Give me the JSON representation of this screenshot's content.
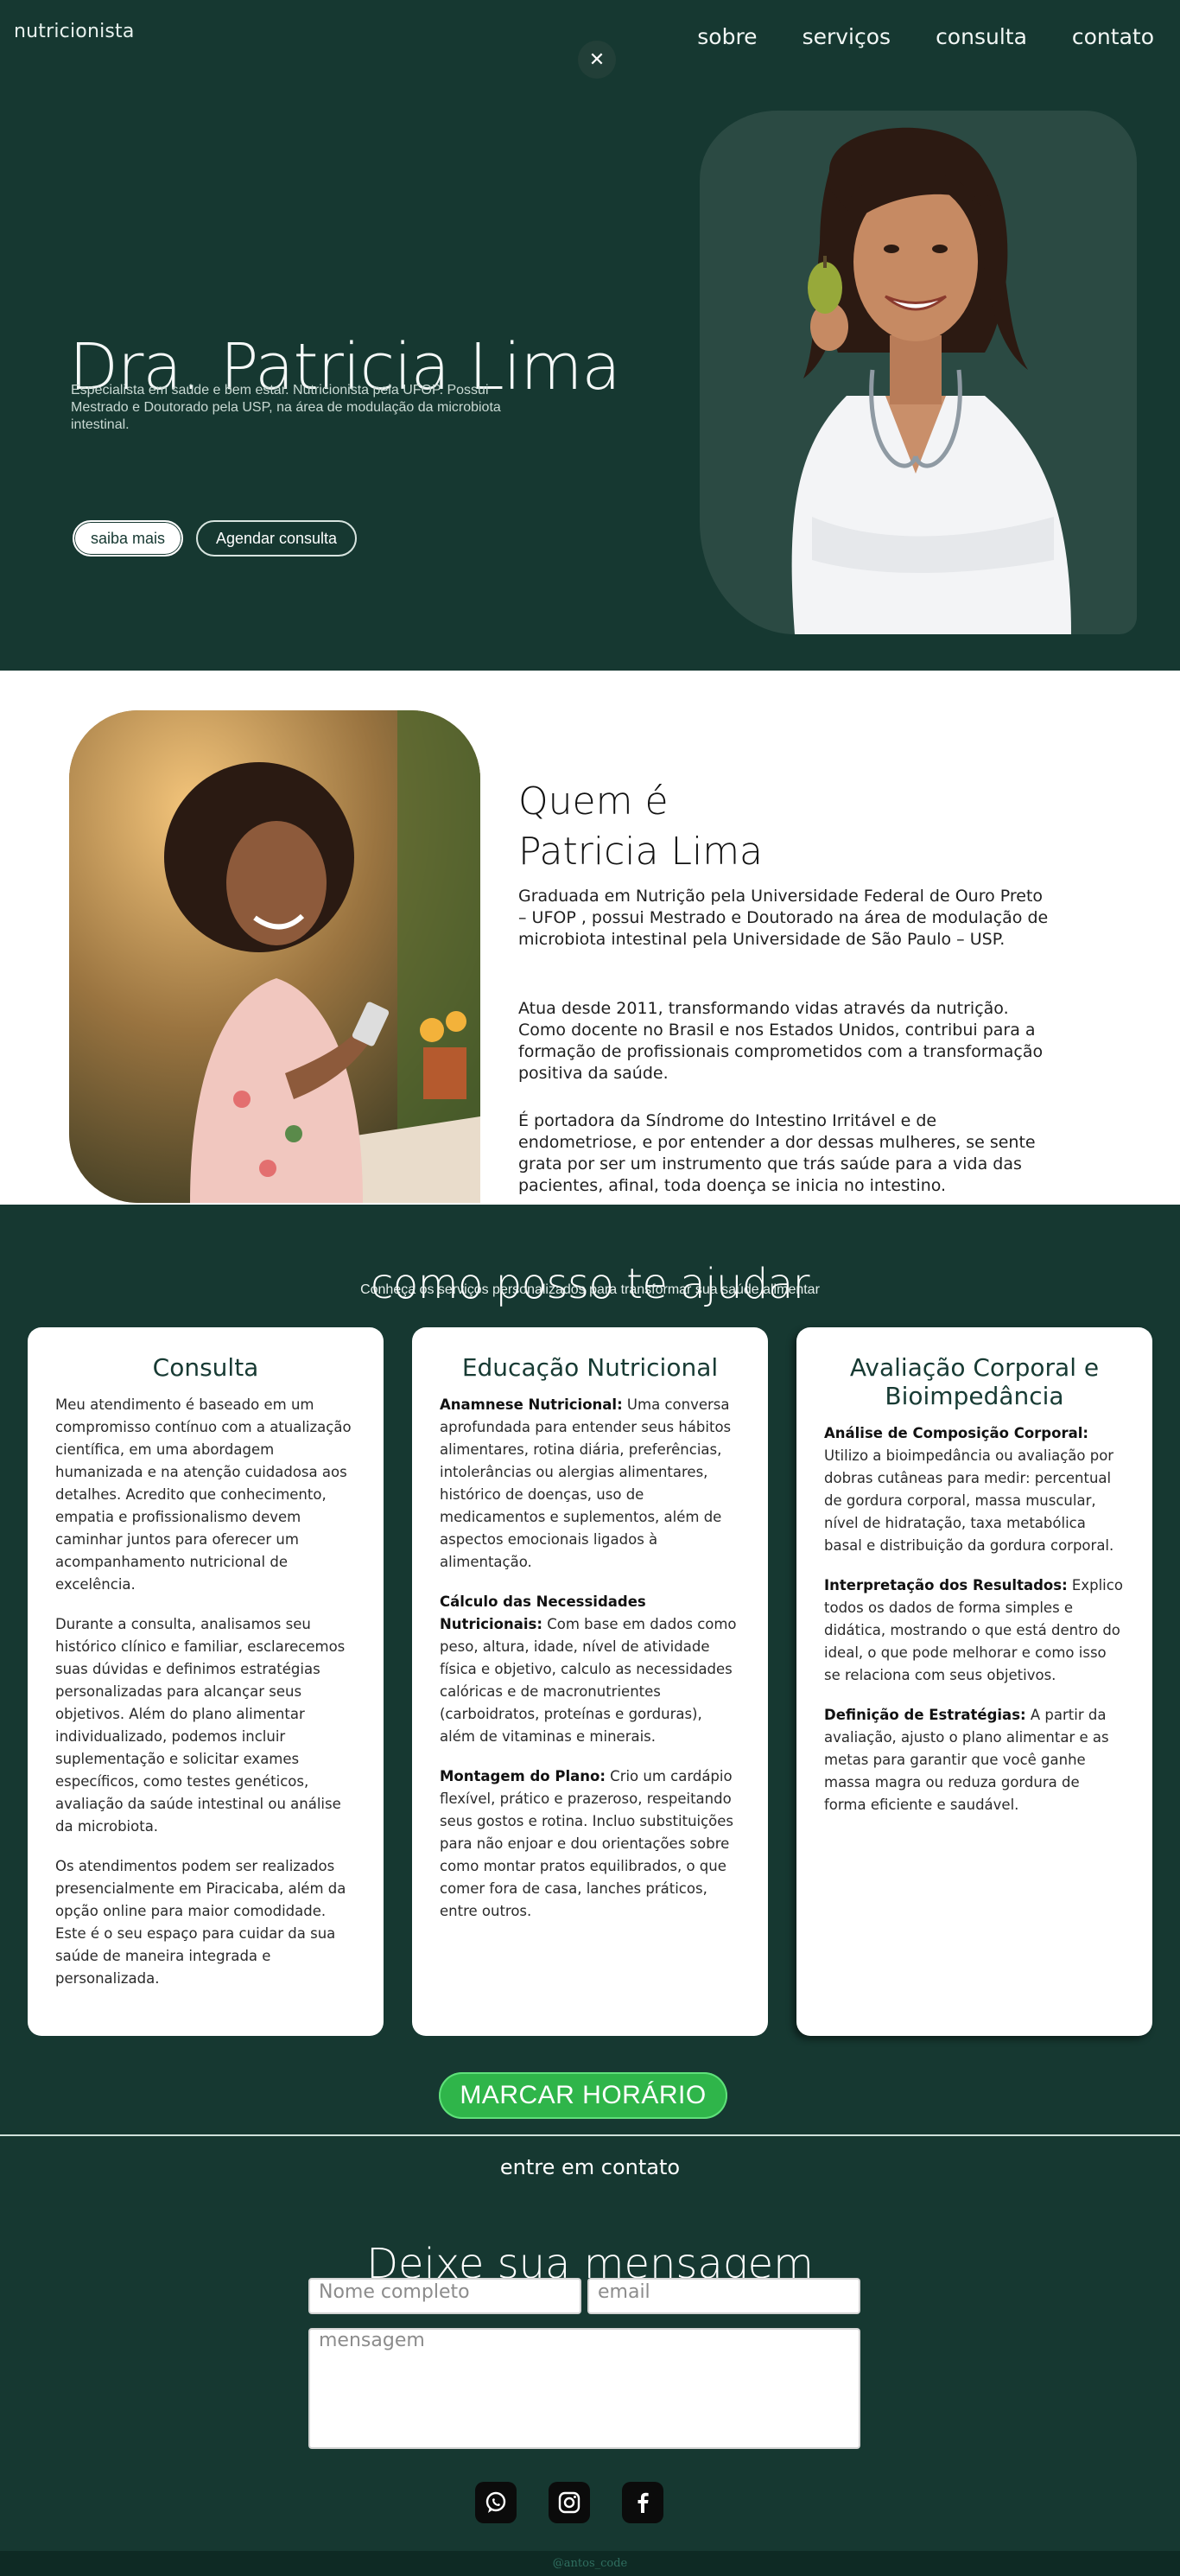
{
  "header": {
    "brand": "nutricionista",
    "nav": [
      "sobre",
      "serviços",
      "consulta",
      "contato"
    ],
    "close_glyph": "✕"
  },
  "hero": {
    "title": "Dra. Patricia Lima",
    "description": "Especialista em saúde e bem estar. Nutricionista pela UFOP. Possui Mestrado e Doutorado pela USP, na área de modulação da microbiota intestinal.",
    "btn_more": "saiba mais",
    "btn_schedule": "Agendar consulta"
  },
  "about": {
    "title_line1": "Quem é",
    "title_line2": "Patricia Lima",
    "p1": "Graduada em Nutrição pela Universidade Federal de Ouro Preto – UFOP , possui Mestrado e Doutorado na área de modulação de microbiota intestinal pela Universidade de São Paulo – USP.",
    "p2": "Atua desde 2011, transformando vidas através da nutrição. Como docente no Brasil e nos Estados Unidos, contribui para a formação de profissionais comprometidos com a transformação positiva da saúde.",
    "p3": "É portadora da Síndrome do Intestino Irritável e de endometriose, e por entender a dor dessas mulheres, se sente grata por ser um instrumento que trás saúde para a vida das pacientes, afinal, toda doença se inicia no intestino."
  },
  "services": {
    "title": "como posso te ajudar",
    "subtitle": "Conheça os serviços personalizados para transformar sua saúde alimentar",
    "card1": {
      "title": "Consulta",
      "p1": "Meu atendimento é baseado em um compromisso contínuo com a atualização científica, em uma abordagem humanizada e na atenção cuidadosa aos detalhes. Acredito que conhecimento, empatia e profissionalismo devem caminhar juntos para oferecer um acompanhamento nutricional de excelência.",
      "p2": "Durante a consulta, analisamos seu histórico clínico e familiar, esclarecemos suas dúvidas e definimos estratégias personalizadas para alcançar seus objetivos. Além do plano alimentar individualizado, podemos incluir suplementação e solicitar exames específicos, como testes genéticos, avaliação da saúde intestinal ou análise da microbiota.",
      "p3": "Os atendimentos podem ser realizados presencialmente em Piracicaba, além da opção online para maior comodidade. Este é o seu espaço para cuidar da sua saúde de maneira integrada e personalizada."
    },
    "card2": {
      "title": "Educação Nutricional",
      "h1": "Anamnese Nutricional:",
      "t1": " Uma conversa aprofundada para entender seus hábitos alimentares, rotina diária, preferências, intolerâncias ou alergias alimentares, histórico de doenças, uso de medicamentos e suplementos, além de aspectos emocionais ligados à alimentação.",
      "h2": "Cálculo das Necessidades Nutricionais:",
      "t2": " Com base em dados como peso, altura, idade, nível de atividade física e objetivo, calculo as necessidades calóricas e de macronutrientes (carboidratos, proteínas e gorduras), além de vitaminas e minerais.",
      "h3": "Montagem do Plano:",
      "t3": " Crio um cardápio flexível, prático e prazeroso, respeitando seus gostos e rotina. Incluo substituições para não enjoar e dou orientações sobre como montar pratos equilibrados, o que comer fora de casa, lanches práticos, entre outros."
    },
    "card3": {
      "title": "Avaliação Corporal e Bioimpedância",
      "h1": "Análise de Composição Corporal:",
      "t1": " Utilizo a bioimpedância ou avaliação por dobras cutâneas para medir: percentual de gordura corporal, massa muscular, nível de hidratação, taxa metabólica basal e distribuição da gordura corporal.",
      "h2": "Interpretação dos Resultados:",
      "t2": " Explico todos os dados de forma simples e didática, mostrando o que está dentro do ideal, o que pode melhorar e como isso se relaciona com seus objetivos.",
      "h3": "Definição de Estratégias:",
      "t3": " A partir da avaliação, ajusto o plano alimentar e as metas para garantir que você ganhe massa magra ou reduza gordura de forma eficiente e saudável."
    },
    "cta": "MARCAR HORÁRIO"
  },
  "contact": {
    "kicker": "entre em contato",
    "title": "Deixe sua mensagem",
    "name_placeholder": "Nome completo",
    "email_placeholder": "email",
    "message_placeholder": "mensagem",
    "social_icons": [
      "whatsapp-icon",
      "instagram-icon",
      "facebook-icon"
    ]
  },
  "footer": {
    "credit": "@antos_code"
  }
}
